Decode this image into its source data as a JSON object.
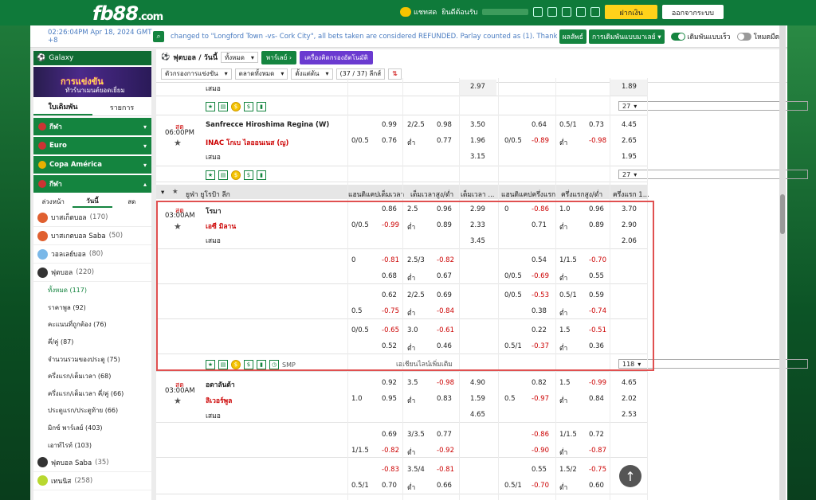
{
  "header": {
    "logo": "fb88",
    "logo_suffix": ".com",
    "chat": "แชทสด",
    "welcome": "ยินดีต้อนรับ",
    "deposit": "ฝากเงิน",
    "logout": "ออกจากระบบ"
  },
  "ticker": {
    "time": "02:26:04PM Apr 18, 2024 GMT +8",
    "message": "changed to \"Longford Town -vs- Cork City\", all bets taken are considered REFUNDED. Parlay counted as (1). Thank",
    "results": "ผลลัพธ์",
    "bet_select": "การเดิมพันแบบมาเลย์",
    "fast_bet": "เดิมพันแบบเร็ว",
    "night_mode": "โหมดมืด"
  },
  "sidebar": {
    "galaxy": "Galaxy",
    "banner_title": "การแข่งขัน",
    "banner_sub": "ทัวร์นาเมนต์ยอดเยี่ยม",
    "tab_bets": "ใบเดิมพัน",
    "tab_list": "รายการ",
    "cats": [
      {
        "label": "กีฬา"
      },
      {
        "label": "Euro"
      },
      {
        "label": "Copa América"
      },
      {
        "label": "กีฬา"
      }
    ],
    "subtabs": [
      "ล่วงหน้า",
      "วันนี้",
      "สด"
    ],
    "sports": [
      {
        "label": "บาสเก็ตบอล",
        "count": "(170)"
      },
      {
        "label": "บาสเกตบอล Saba",
        "count": "(50)"
      },
      {
        "label": "วอลเลย์บอล",
        "count": "(80)"
      },
      {
        "label": "ฟุตบอล",
        "count": "(220)"
      }
    ],
    "subs": [
      "ทั้งหมด (117)",
      "ราคาพูล (92)",
      "คะแนนที่ถูกต้อง (76)",
      "คี่/คู่ (87)",
      "จำนวนรวมของประตู (75)",
      "ครึ่งแรก/เต็มเวลา (68)",
      "ครึ่งแรก/เต็มเวลา คี่/คู่ (66)",
      "ประตูแรก/ประตูท้าย (66)",
      "มิกซ์ พาร์เลย์ (403)",
      "เอาท์ไรท์ (103)"
    ],
    "sports2": [
      {
        "label": "ฟุตบอล Saba",
        "count": "(35)"
      },
      {
        "label": "เทนนิส",
        "count": "(258)"
      }
    ]
  },
  "filters": {
    "sport": "ฟุตบอล / วันนี้",
    "all": "ทั้งหมด",
    "parlay": "พาร์เลย์",
    "calc": "เครื่องคิดกรองอัตโนมัติ",
    "comp_filter": "ตัวกรองการแข่งขัน",
    "market": "ตลาดทั้งหมด",
    "sort": "ตั้งแต่ต้น",
    "count": "(37 / 37) ลีกส์"
  },
  "league": {
    "name": "ยูฟ่า ยูโรป้า ลีก",
    "cols": [
      "แฮนดิแคปเต็มเวลา",
      "เต็มเวลาสูง/ต่ำ",
      "เต็มเวลา ...",
      "แฮนดิแคปครึ่งแรก",
      "ครึ่งแรกสูง/ต่ำ",
      "ครึ่งแรก 1..."
    ]
  },
  "top": {
    "draw": "เสมอ",
    "v1": "2.97",
    "v2": "1.89",
    "more": "27"
  },
  "match1": {
    "status": "สด",
    "time": "06:00PM",
    "home": "Sanfrecce Hiroshima Regina (W)",
    "away": "INAC โกเบ ไลออนเนส (ญ)",
    "draw": "เสมอ",
    "more": "27",
    "r1": [
      "0.99",
      "2/2.5",
      "0.98",
      "3.50",
      "0.64",
      "0.5/1",
      "0.73",
      "4.45"
    ],
    "r2": [
      "0/0.5",
      "0.76",
      "ต่ำ",
      "0.77",
      "1.96",
      "0/0.5",
      "-0.89",
      "ต่ำ",
      "-0.98",
      "2.65"
    ],
    "r3": [
      "3.15",
      "1.95"
    ]
  },
  "match2": {
    "status": "สด",
    "time": "03:00AM",
    "home": "โรมา",
    "away": "เอซี มิลาน",
    "draw": "เสมอ",
    "more": "118",
    "expand": "เอเชียนไลน์เพิ่มเติม",
    "smp": "SMP",
    "r1": [
      "0.86",
      "2.5",
      "0.96",
      "2.99",
      "0",
      "-0.86",
      "1.0",
      "0.96",
      "3.70"
    ],
    "r2": [
      "0/0.5",
      "-0.99",
      "ต่ำ",
      "0.89",
      "2.33",
      "0.71",
      "ต่ำ",
      "0.89",
      "2.90"
    ],
    "r3": [
      "3.45",
      "2.06"
    ],
    "b1": [
      "0",
      "-0.81",
      "2.5/3",
      "-0.82",
      "0.54",
      "1/1.5",
      "-0.70"
    ],
    "b2": [
      "0.68",
      "ต่ำ",
      "0.67",
      "0/0.5",
      "-0.69",
      "ต่ำ",
      "0.55"
    ],
    "b3": [
      "0.62",
      "2/2.5",
      "0.69",
      "0/0.5",
      "-0.53",
      "0.5/1",
      "0.59"
    ],
    "b4": [
      "0.5",
      "-0.75",
      "ต่ำ",
      "-0.84",
      "0.38",
      "ต่ำ",
      "-0.74"
    ],
    "b5": [
      "0/0.5",
      "-0.65",
      "3.0",
      "-0.61",
      "0.22",
      "1.5",
      "-0.51"
    ],
    "b6": [
      "0.52",
      "ต่ำ",
      "0.46",
      "0.5/1",
      "-0.37",
      "ต่ำ",
      "0.36"
    ]
  },
  "match3": {
    "status": "สด",
    "time": "03:00AM",
    "home": "อตาลันต้า",
    "away": "ลิเวอร์พูล",
    "draw": "เสมอ",
    "r1": [
      "0.92",
      "3.5",
      "-0.98",
      "4.90",
      "0.82",
      "1.5",
      "-0.99",
      "4.65"
    ],
    "r2": [
      "1.0",
      "0.95",
      "ต่ำ",
      "0.83",
      "1.59",
      "0.5",
      "-0.97",
      "ต่ำ",
      "0.84",
      "2.02"
    ],
    "r3": [
      "4.65",
      "2.53"
    ],
    "b1": [
      "0.69",
      "3/3.5",
      "0.77",
      "-0.86",
      "1/1.5",
      "0.72"
    ],
    "b2": [
      "1/1.5",
      "-0.82",
      "ต่ำ",
      "-0.92",
      "-0.90",
      "ต่ำ",
      "-0.87"
    ],
    "b3": [
      "-0.83",
      "3.5/4",
      "-0.81",
      "0.55",
      "1.5/2",
      "-0.75"
    ],
    "b4": [
      "0.5/1",
      "0.70",
      "ต่ำ",
      "0.66",
      "0.5/1",
      "-0.70",
      "ต่ำ",
      "0.60"
    ]
  }
}
